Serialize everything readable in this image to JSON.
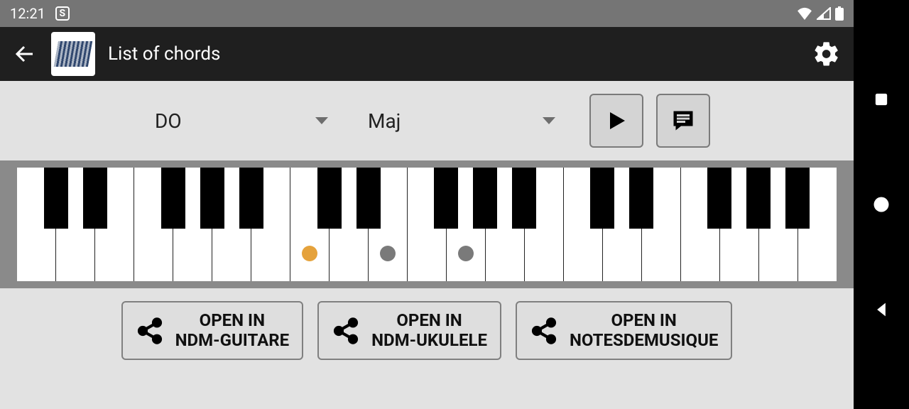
{
  "status": {
    "time": "12:21"
  },
  "appbar": {
    "title": "List of chords"
  },
  "controls": {
    "note": "DO",
    "quality": "Maj"
  },
  "piano": {
    "white_keys": 21,
    "black_pattern": [
      1,
      1,
      0,
      1,
      1,
      1,
      0
    ],
    "dots": [
      {
        "key": 7,
        "type": "root"
      },
      {
        "key": 9,
        "type": "other"
      },
      {
        "key": 11,
        "type": "other"
      }
    ]
  },
  "share": {
    "open_in": "OPEN IN",
    "buttons": [
      {
        "line2": "NDM-GUITARE"
      },
      {
        "line2": "NDM-UKULELE"
      },
      {
        "line2": "NOTESDEMUSIQUE"
      }
    ]
  }
}
